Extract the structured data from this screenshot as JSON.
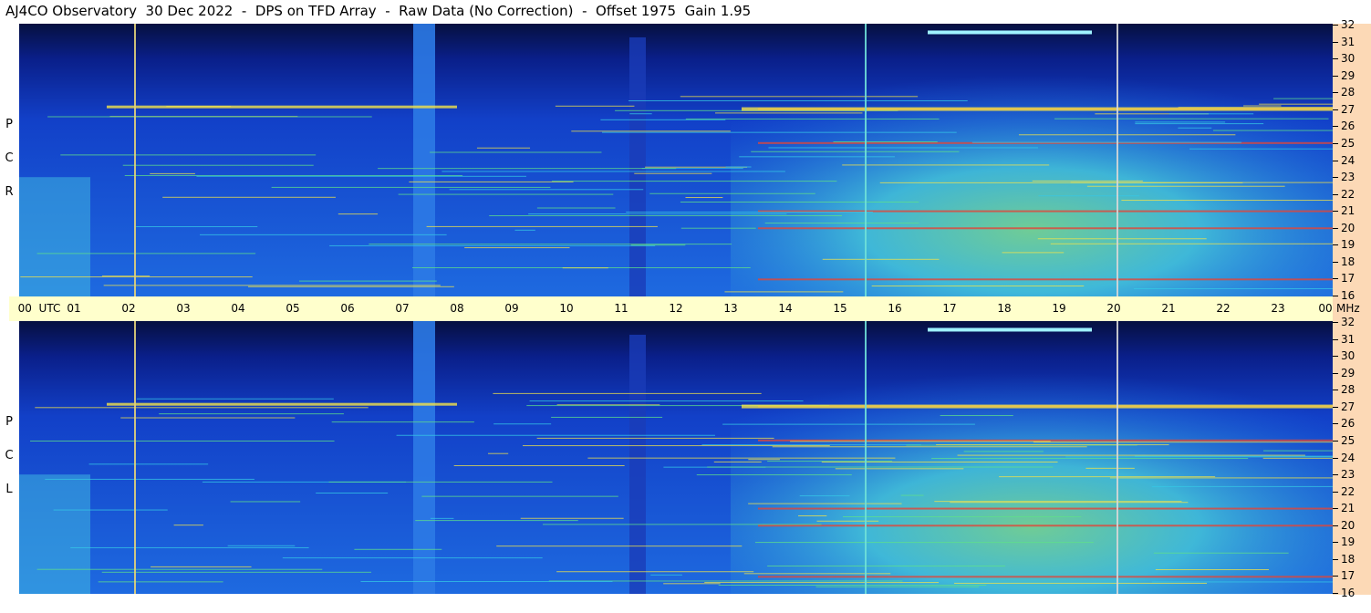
{
  "title": "AJ4CO Observatory  30 Dec 2022  -  DPS on TFD Array  -  Raw Data (No Correction)  -  Offset 1975  Gain 1.95",
  "panels": [
    {
      "id": "rcp",
      "letters": [
        "R",
        "C",
        "P"
      ]
    },
    {
      "id": "lcp",
      "letters": [
        "L",
        "C",
        "P"
      ]
    }
  ],
  "utc_axis": {
    "labels": [
      "00  UTC",
      "01",
      "02",
      "03",
      "04",
      "05",
      "06",
      "07",
      "08",
      "09",
      "10",
      "11",
      "12",
      "13",
      "14",
      "15",
      "16",
      "17",
      "18",
      "19",
      "20",
      "21",
      "22",
      "23",
      "00"
    ]
  },
  "freq_axis": {
    "unit": "MHz",
    "ticks": [
      "32",
      "31",
      "30",
      "29",
      "28",
      "27",
      "26",
      "25",
      "24",
      "23",
      "22",
      "21",
      "20",
      "19",
      "18",
      "17",
      "16"
    ]
  },
  "chart_data": {
    "type": "heatmap",
    "title": "AJ4CO Observatory  30 Dec 2022  -  DPS on TFD Array  -  Raw Data (No Correction)  -  Offset 1975  Gain 1.95",
    "x_axis": {
      "label": "UTC",
      "range_hours": [
        0,
        24
      ]
    },
    "y_axis": {
      "label": "MHz",
      "range": [
        16,
        32
      ]
    },
    "panels": [
      "RCP",
      "LCP"
    ],
    "vertical_markers_utc": [
      2.1,
      15.45,
      20.05
    ],
    "bright_column_utc": [
      7.2,
      7.6
    ],
    "dark_column_utc": [
      11.15,
      11.45
    ],
    "strong_horizontal_lines_mhz": [
      17.0,
      20.0,
      21.0,
      25.0,
      27.0
    ],
    "colors": {
      "background": "#0b1a6a",
      "noise_blue": "#1c5ad8",
      "active_cyan": "#35c8e6",
      "hot_yellow": "#f2e34a",
      "hot_red": "#e0463a"
    }
  }
}
